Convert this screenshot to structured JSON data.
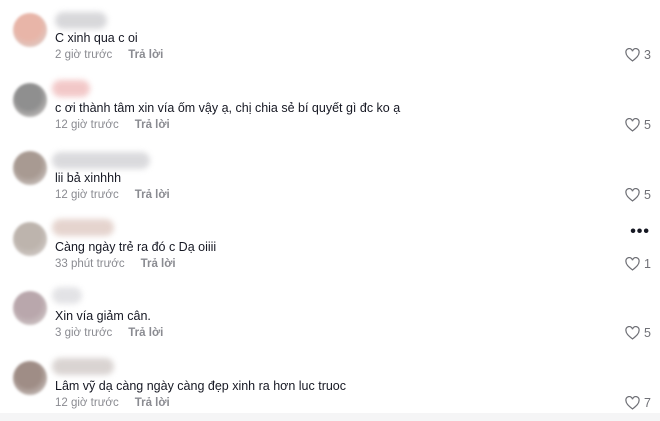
{
  "comments": [
    {
      "text": "C xinh qua c oi",
      "time": "2 giờ trước",
      "reply": "Trả lời",
      "likes": "3",
      "avatar_color": "#e8b5a8",
      "name_color": "#d6d6d9"
    },
    {
      "text": "c ơi thành tâm xin vía ốm vậy ạ, chị chia sẻ bí quyết gì đc ko ạ",
      "time": "12 giờ trước",
      "reply": "Trả lời",
      "likes": "5",
      "avatar_color": "#8f8f8f",
      "name_color": "#f2c6c6"
    },
    {
      "text": "lii bả xinhhh",
      "time": "12 giờ trước",
      "reply": "Trả lời",
      "likes": "5",
      "avatar_color": "#a89a92",
      "name_color": "#d9d9dc"
    },
    {
      "text": "Càng ngày trẻ ra đó c Dạ oiiii",
      "time": "33 phút trước",
      "reply": "Trả lời",
      "likes": "1",
      "avatar_color": "#bdb4ad",
      "name_color": "#e4d2cc"
    },
    {
      "text": "Xin vía giảm cân.",
      "time": "3 giờ trước",
      "reply": "Trả lời",
      "likes": "5",
      "avatar_color": "#b9a7ac",
      "name_color": "#e2e2e5"
    },
    {
      "text": "Lâm vỹ dạ càng ngày càng đẹp xinh ra hơn luc truoc",
      "time": "12 giờ trước",
      "reply": "Trả lời",
      "likes": "7",
      "avatar_color": "#9f8d86",
      "name_color": "#d8d2d0"
    }
  ],
  "icons": {
    "like": "heart-outline-icon",
    "more": "more-dots-icon"
  },
  "more_glyph": "•••"
}
